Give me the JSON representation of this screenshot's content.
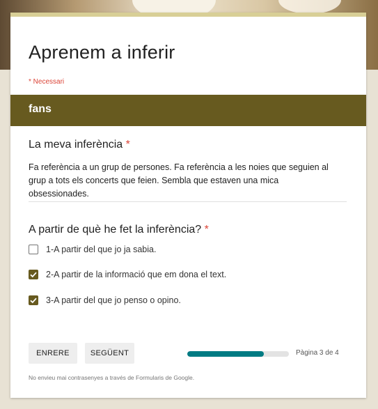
{
  "form": {
    "title": "Aprenem a inferir",
    "required_note": "* Necessari"
  },
  "section": {
    "title": "fans"
  },
  "question1": {
    "label": "La meva inferència",
    "required_mark": "*",
    "answer": "Fa referència a un grup de persones. Fa referència a les noies que seguien al grup a tots els concerts que feien. Sembla que estaven una mica obsessionades."
  },
  "question2": {
    "label": "A partir de què he fet la inferència?",
    "required_mark": "*",
    "options": [
      {
        "label": "1-A partir del que jo ja sabia.",
        "checked": false
      },
      {
        "label": "2-A partir de la informació que em dona el text.",
        "checked": true
      },
      {
        "label": "3-A partir del que jo penso o opino.",
        "checked": true
      }
    ]
  },
  "nav": {
    "back_label": "ENRERE",
    "next_label": "SEGÜENT"
  },
  "progress": {
    "page_text": "Pàgina 3 de 4",
    "fraction": 0.75
  },
  "footer": {
    "note": "No envieu mai contrasenyes a través de Formularis de Google."
  },
  "colors": {
    "theme": "#675a1f",
    "accent_bar": "#d8cf96",
    "progress": "#007b83",
    "required": "#db4437"
  }
}
